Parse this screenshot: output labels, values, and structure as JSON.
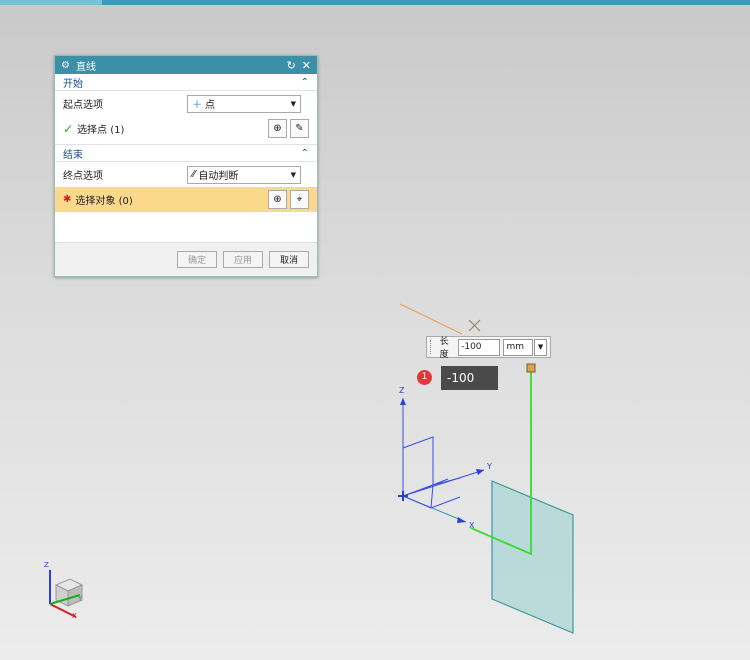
{
  "dialog": {
    "title": "直线",
    "start_section": "开始",
    "start_option_label": "起点选项",
    "start_option_value": "点",
    "select_point_label": "选择点 (1)",
    "end_section": "结束",
    "end_option_label": "终点选项",
    "end_option_value": "自动判断",
    "select_object_label": "选择对象 (0)",
    "ok_label": "确定",
    "apply_label": "应用",
    "cancel_label": "取消"
  },
  "length_input": {
    "label": "长度",
    "value": "-100",
    "unit": "mm"
  },
  "tooltip": {
    "badge": "1",
    "value": "-100"
  },
  "axes": {
    "x": "X",
    "y": "Y",
    "z": "Z"
  },
  "colors": {
    "title_bar": "#3b8fa6",
    "highlight_row": "#fbd98a",
    "line_green": "#33dd33",
    "plane_fill": "#a9d6d4",
    "csys_blue": "#2b3fd6"
  }
}
